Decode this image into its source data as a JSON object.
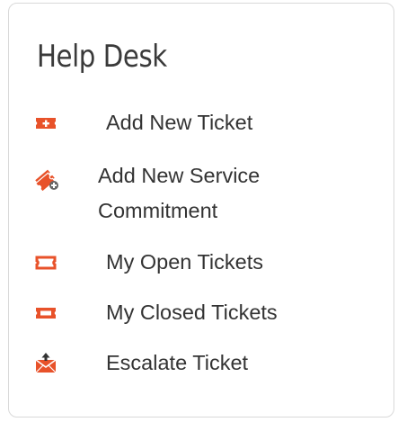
{
  "panel": {
    "title": "Help Desk",
    "accent_color": "#e8522a",
    "items": [
      {
        "label": "Add New Ticket",
        "icon": "ticket-plus-icon"
      },
      {
        "label": "Add New Service Commitment",
        "icon": "tickets-plus-icon"
      },
      {
        "label": "My Open Tickets",
        "icon": "open-ticket-icon"
      },
      {
        "label": "My Closed Tickets",
        "icon": "closed-ticket-icon"
      },
      {
        "label": "Escalate Ticket",
        "icon": "envelope-up-icon"
      }
    ]
  }
}
